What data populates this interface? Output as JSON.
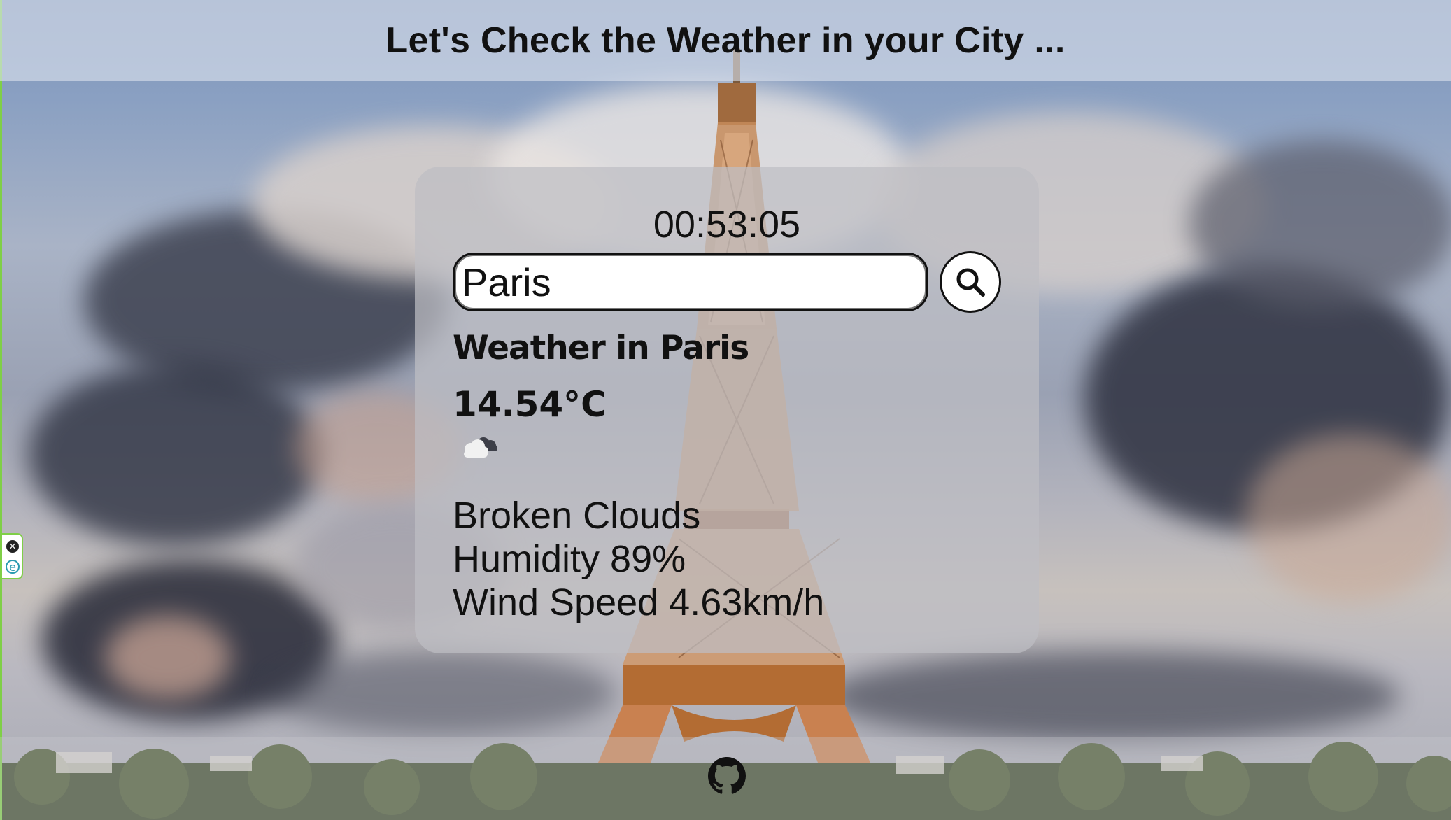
{
  "header": {
    "title": "Let's Check the Weather in your City ..."
  },
  "card": {
    "clock": "00:53:05",
    "search": {
      "value": "Paris",
      "placeholder": "",
      "button_icon": "search-icon"
    },
    "city_heading": "Weather in Paris",
    "temperature": "14.54°C",
    "weather_icon": "broken-clouds-icon",
    "description": "Broken Clouds",
    "humidity": "Humidity 89%",
    "wind": "Wind Speed 4.63km/h"
  },
  "footer": {
    "link_icon": "github-icon"
  },
  "extension": {
    "close_icon": "close-icon",
    "badge_icon": "e-icon"
  },
  "colors": {
    "text": "#111111",
    "card_bg": "#bebec4",
    "extension_border": "#7fcf47"
  }
}
